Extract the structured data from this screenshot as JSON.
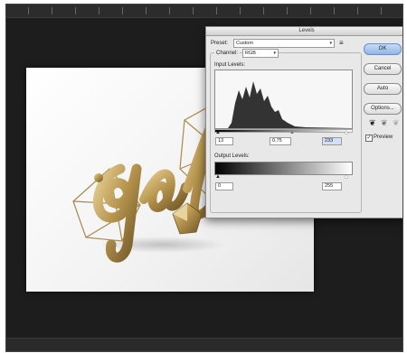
{
  "window": {
    "title": "Levels"
  },
  "preset": {
    "label": "Preset:",
    "value": "Custom"
  },
  "channel": {
    "label": "Channel:",
    "value": "RGB"
  },
  "input_levels": {
    "label": "Input Levels:",
    "shadow": "13",
    "midtone": "0.75",
    "highlight": "233"
  },
  "output_levels": {
    "label": "Output Levels:",
    "low": "0",
    "high": "255"
  },
  "buttons": {
    "ok": "OK",
    "cancel": "Cancel",
    "auto": "Auto",
    "options": "Options..."
  },
  "preview": {
    "label": "Preview",
    "checked": true
  },
  "colors": {
    "default_button": "#8fb6e6",
    "gold": "#b8964f",
    "workspace": "#1d1d1d"
  },
  "icons": [
    "preset-menu-icon",
    "eyedropper-black-icon",
    "eyedropper-gray-icon",
    "eyedropper-white-icon",
    "checkbox-icon"
  ]
}
